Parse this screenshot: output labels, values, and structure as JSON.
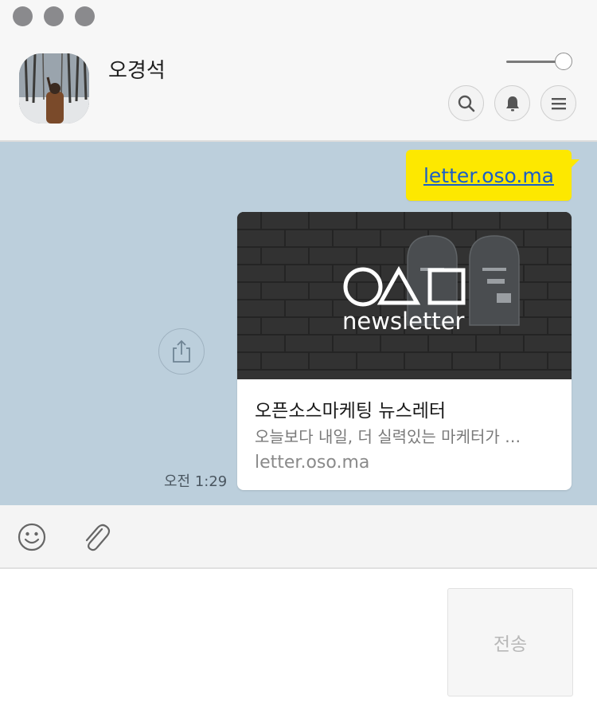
{
  "window": {
    "controls": [
      "close",
      "minimize",
      "zoom"
    ]
  },
  "header": {
    "contact_name": "오경석",
    "avatar_icon": "profile-photo",
    "zoom_level": 0.85,
    "buttons": [
      {
        "icon": "search-icon"
      },
      {
        "icon": "bell-icon"
      },
      {
        "icon": "menu-icon"
      }
    ]
  },
  "chat": {
    "background_color": "#bccfdc",
    "message": {
      "link_text": "letter.oso.ma",
      "bubble_color": "#fde800"
    },
    "link_preview": {
      "title": "오픈소스마케팅 뉴스레터",
      "description": "오늘보다 내일, 더 실력있는 마케터가 …",
      "url": "letter.oso.ma",
      "image_text": "newsletter"
    },
    "share_icon": "share-icon",
    "timestamp": "오전 1:29"
  },
  "toolbar": {
    "emoji_icon": "emoji-icon",
    "attach_icon": "paperclip-icon"
  },
  "compose": {
    "send_label": "전송"
  }
}
